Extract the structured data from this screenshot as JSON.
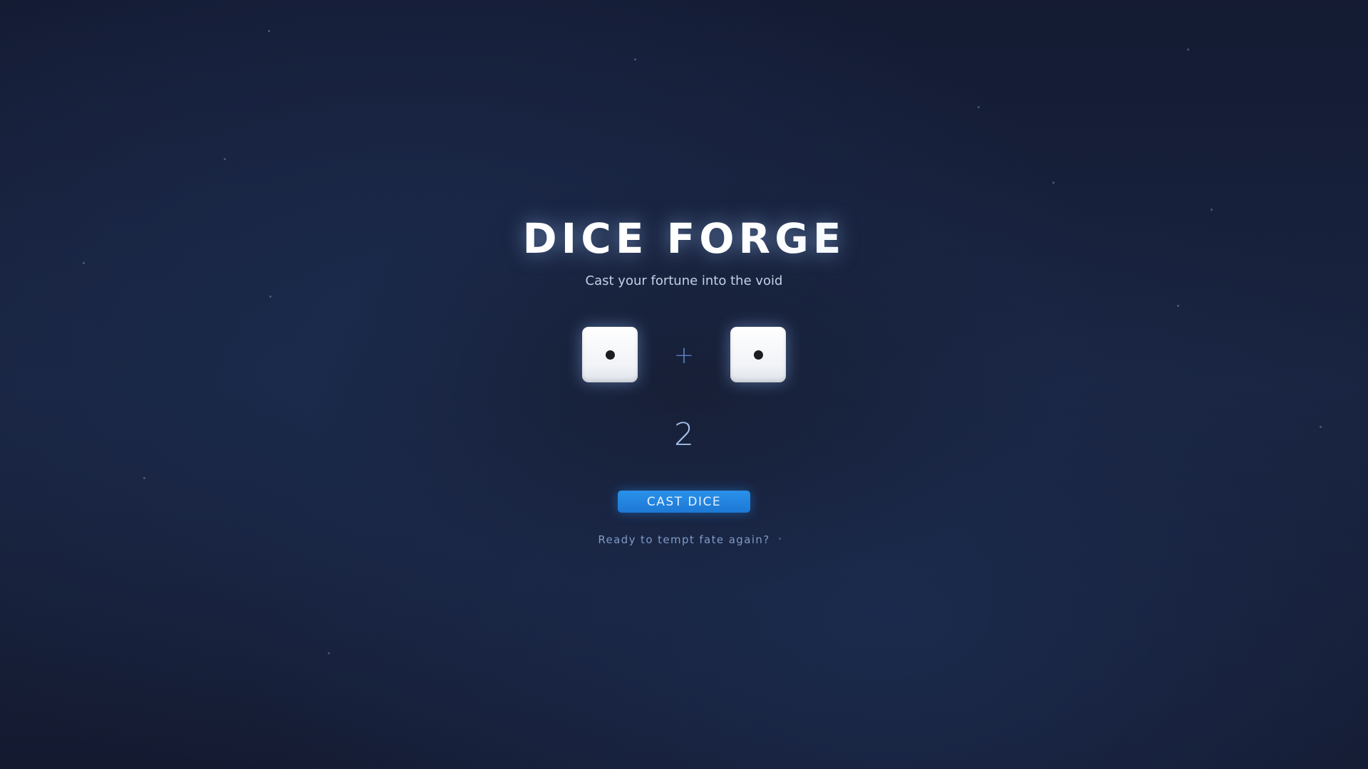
{
  "game": {
    "title": "DICE FORGE",
    "subtitle": "Cast your fortune into the void"
  },
  "dice": [
    {
      "value": 1
    },
    {
      "value": 1
    }
  ],
  "operator": "+",
  "total": "2",
  "actions": {
    "cast_label": "CAST DICE"
  },
  "status_message": "Ready to tempt fate again?",
  "colors": {
    "accent": "#2a91ea",
    "background": "#192440",
    "die_face": "#ffffff",
    "pip": "#1c1c22"
  },
  "icons": {
    "die_left": "die-face-one-icon",
    "die_right": "die-face-one-icon"
  }
}
